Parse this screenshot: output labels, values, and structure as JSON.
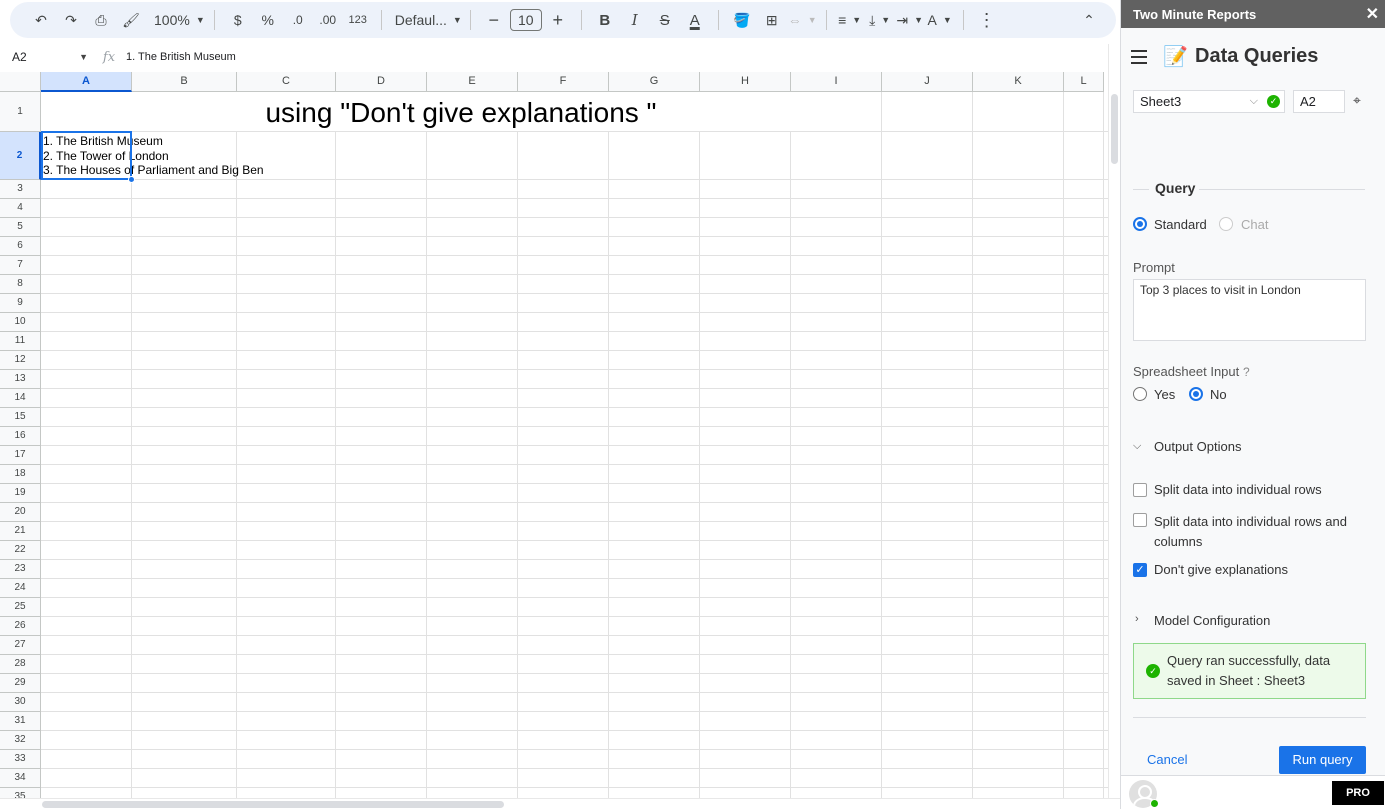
{
  "toolbar": {
    "zoom": "100%",
    "currency": "$",
    "percent": "%",
    "decrease_decimal": ".0",
    "increase_decimal": ".00",
    "number_format": "123",
    "font": "Defaul...",
    "minus": "−",
    "font_size": "10",
    "plus": "+",
    "bold": "B",
    "italic": "I",
    "strike": "S",
    "text_color": "A",
    "text_rotate": "A"
  },
  "formula_bar": {
    "cell_ref": "A2",
    "fx": "fx",
    "value": "1. The British Museum"
  },
  "grid": {
    "columns": [
      "A",
      "B",
      "C",
      "D",
      "E",
      "F",
      "G",
      "H",
      "I",
      "J",
      "K",
      "L"
    ],
    "rows": [
      "1",
      "2",
      "3",
      "4",
      "5",
      "6",
      "7",
      "8",
      "9",
      "10",
      "11",
      "12",
      "13",
      "14",
      "15",
      "16",
      "17",
      "18",
      "19",
      "20",
      "21",
      "22",
      "23",
      "24",
      "25",
      "26",
      "27",
      "28",
      "29",
      "30",
      "31",
      "32",
      "33",
      "34",
      "35"
    ],
    "title_cell": "using \"Don't give explanations \"",
    "a2_lines": [
      "1. The British Museum",
      "2. The Tower of London",
      "3. The Houses of Parliament and Big Ben"
    ]
  },
  "panel": {
    "header_title": "Two Minute Reports",
    "close": "✕",
    "app_title": "Data Queries",
    "sheet": "Sheet3",
    "cell": "A2",
    "query_heading": "Query",
    "mode_standard": "Standard",
    "mode_chat": "Chat",
    "prompt_label": "Prompt",
    "prompt_value": "Top 3 places to visit in London",
    "ssinput_label": "Spreadsheet Input",
    "help": "?",
    "yes": "Yes",
    "no": "No",
    "output_options": "Output Options",
    "opt_split_rows": "Split data into individual rows",
    "opt_split_rows_cols": "Split data into individual rows and columns",
    "opt_no_explanations": "Don't give explanations",
    "model_config": "Model Configuration",
    "success": "Query ran successfully, data saved in Sheet : Sheet3",
    "cancel": "Cancel",
    "run": "Run query",
    "pro": "PRO"
  }
}
